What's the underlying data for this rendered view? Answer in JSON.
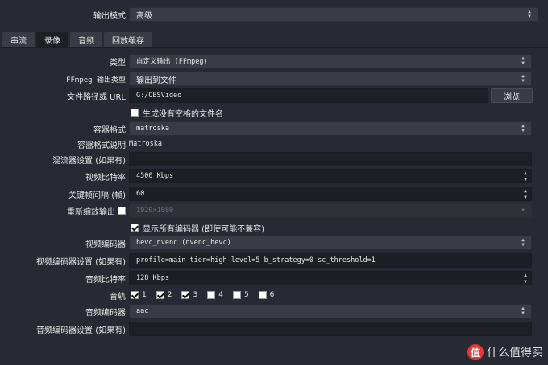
{
  "output_mode": {
    "label": "输出模式",
    "value": "高级"
  },
  "tabs": [
    {
      "label": "串流",
      "active": false
    },
    {
      "label": "录像",
      "active": true
    },
    {
      "label": "音频",
      "active": false
    },
    {
      "label": "回放缓存",
      "active": false
    }
  ],
  "recording": {
    "type": {
      "label": "类型",
      "value": "自定义输出 (FFmpeg)"
    },
    "ffmpeg_output_type": {
      "label": "FFmpeg 输出类型",
      "value": "输出到文件"
    },
    "file_path": {
      "label": "文件路径或 URL",
      "value": "G:/OBSVideo",
      "browse_label": "浏览"
    },
    "no_space_filename": {
      "label": "生成没有空格的文件名",
      "checked": false
    },
    "container_format": {
      "label": "容器格式",
      "value": "matroska"
    },
    "container_desc": {
      "label": "容器格式说明",
      "value": "Matroska"
    },
    "muxer_settings": {
      "label": "混流器设置 (如果有)",
      "value": ""
    },
    "video_bitrate": {
      "label": "视频比特率",
      "value": "4500 Kbps"
    },
    "keyframe_interval": {
      "label": "关键帧间隔 (帧)",
      "value": "60"
    },
    "rescale_output": {
      "label": "重新缩放输出",
      "checked": false,
      "value": "1920x1080"
    },
    "show_all_encoders": {
      "label": "显示所有编码器 (即使可能不兼容)",
      "checked": true
    },
    "video_encoder": {
      "label": "视频编码器",
      "value": "hevc_nvenc (nvenc_hevc)"
    },
    "video_encoder_settings": {
      "label": "视频编码器设置 (如果有)",
      "value": "profile=main tier=high level=5 b_strategy=0 sc_threshold=1"
    },
    "audio_bitrate": {
      "label": "音频比特率",
      "value": "128 Kbps"
    },
    "audio_track": {
      "label": "音轨",
      "tracks": [
        {
          "num": "1",
          "checked": true
        },
        {
          "num": "2",
          "checked": true
        },
        {
          "num": "3",
          "checked": true
        },
        {
          "num": "4",
          "checked": false
        },
        {
          "num": "5",
          "checked": false
        },
        {
          "num": "6",
          "checked": false
        }
      ]
    },
    "audio_encoder": {
      "label": "音频编码器",
      "value": "aac"
    },
    "audio_encoder_settings": {
      "label": "音频编码器设置 (如果有)",
      "value": ""
    }
  },
  "watermark": {
    "text": "什么值得买",
    "icon": "值"
  }
}
